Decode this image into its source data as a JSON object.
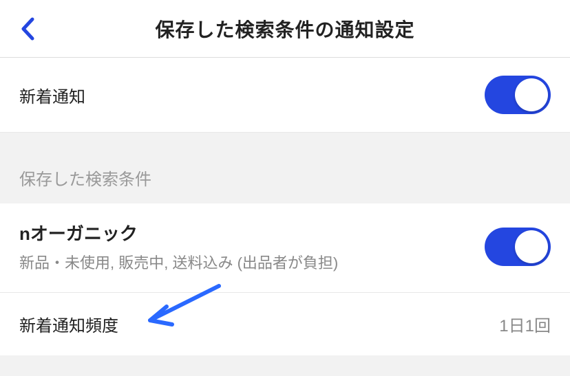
{
  "header": {
    "title": "保存した検索条件の通知設定"
  },
  "notification": {
    "label": "新着通知",
    "enabled": true
  },
  "section": {
    "title": "保存した検索条件"
  },
  "savedSearch": {
    "title": "nオーガニック",
    "subtitle": "新品・未使用, 販売中, 送料込み (出品者が負担)",
    "enabled": true
  },
  "frequency": {
    "label": "新着通知頻度",
    "value": "1日1回"
  },
  "colors": {
    "accent": "#2446e0",
    "arrowAnnotation": "#2a69ff"
  }
}
